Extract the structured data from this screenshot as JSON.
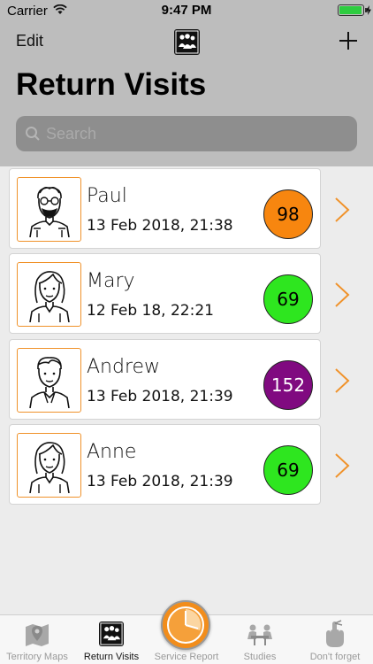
{
  "status_bar": {
    "carrier": "Carrier",
    "time": "9:47 PM"
  },
  "nav": {
    "edit_label": "Edit",
    "add_icon": "plus-icon",
    "logo_icon": "people-logo-icon"
  },
  "page": {
    "title": "Return Visits"
  },
  "search": {
    "placeholder": "Search",
    "value": ""
  },
  "visits": [
    {
      "name": "Paul",
      "date": "13 Feb 2018, 21:38",
      "count": "98",
      "badge_color": "#f7860f",
      "avatar": "man-beard-avatar"
    },
    {
      "name": "Mary",
      "date": "12 Feb 18, 22:21",
      "count": "69",
      "badge_color": "#2ee61f",
      "avatar": "woman-avatar"
    },
    {
      "name": "Andrew",
      "date": "13 Feb 2018, 21:39",
      "count": "152",
      "badge_color": "#800a80",
      "avatar": "young-man-avatar"
    },
    {
      "name": "Anne",
      "date": "13 Feb 2018, 21:39",
      "count": "69",
      "badge_color": "#2ee61f",
      "avatar": "woman-avatar"
    }
  ],
  "tabbar": {
    "tabs": [
      {
        "label": "Territory Maps",
        "icon": "map-icon",
        "active": false
      },
      {
        "label": "Return Visits",
        "icon": "people-icon",
        "active": true
      },
      {
        "label": "Service Report",
        "icon": "clock-icon",
        "active": false
      },
      {
        "label": "Studies",
        "icon": "study-table-icon",
        "active": false
      },
      {
        "label": "Don't forget",
        "icon": "finger-ribbon-icon",
        "active": false
      }
    ]
  },
  "colors": {
    "accent": "#f0922a",
    "header_bg": "#bdbdbd",
    "list_bg": "#ececec"
  }
}
